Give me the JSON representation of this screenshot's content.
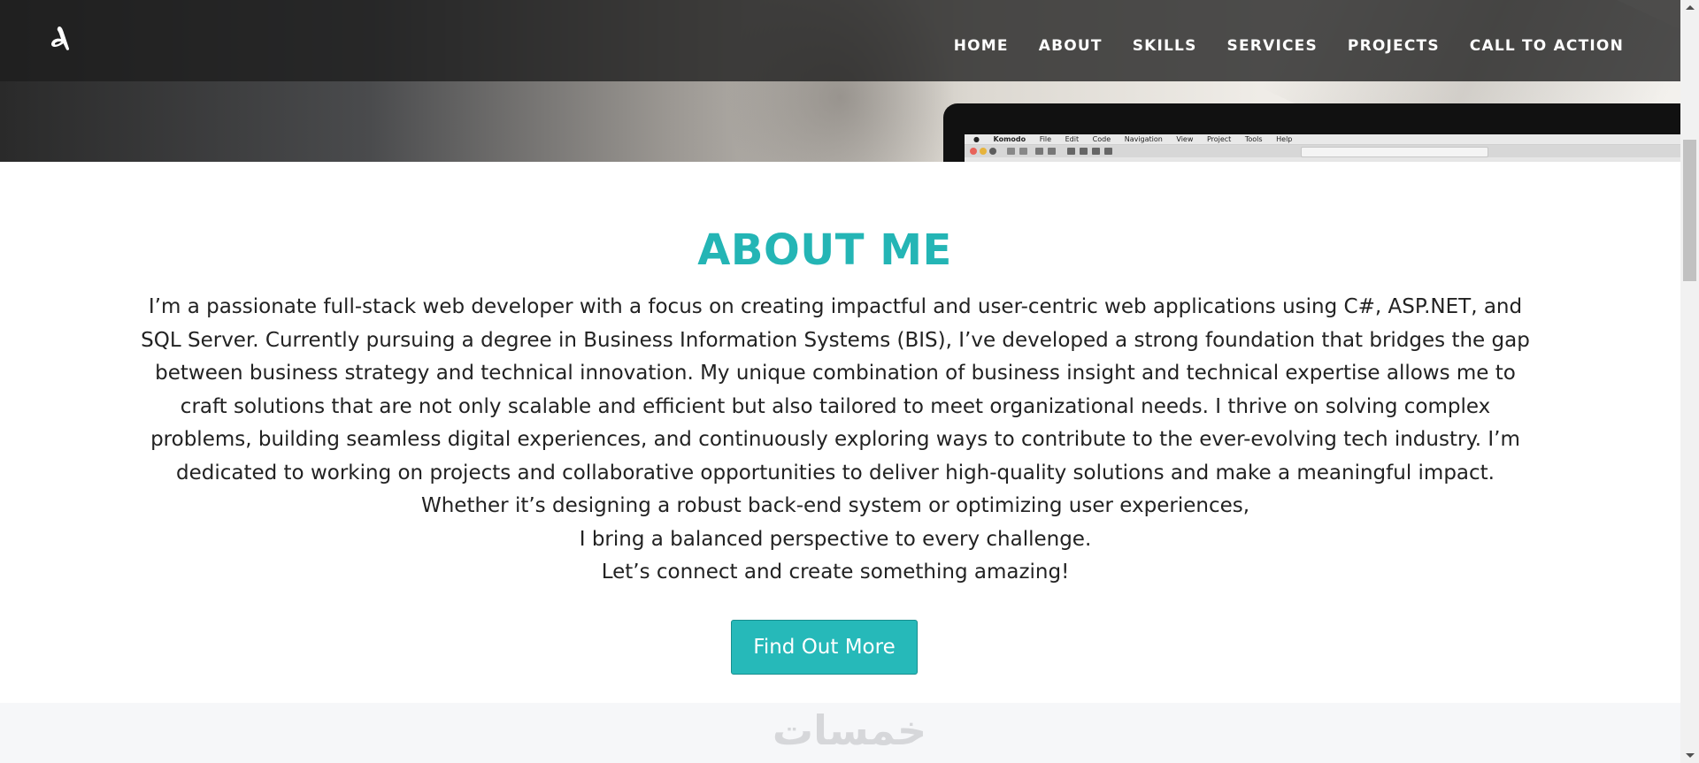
{
  "nav": {
    "logo_icon": "stylized-A-logo-icon",
    "items": [
      "HOME",
      "ABOUT",
      "SKILLS",
      "SERVICES",
      "PROJECTS",
      "CALL TO ACTION"
    ]
  },
  "hero": {
    "laptop_menu": [
      "Komodo",
      "File",
      "Edit",
      "Code",
      "Navigation",
      "View",
      "Project",
      "Tools",
      "Help"
    ]
  },
  "about": {
    "title": "ABOUT ME",
    "paragraph": "I’m a passionate full-stack web developer with a focus on creating impactful and user-centric web applications using C#, ASP.NET, and SQL Server. Currently pursuing a degree in Business Information Systems (BIS), I’ve developed a strong foundation that bridges the gap between business strategy and technical innovation. My unique combination of business insight and technical expertise allows me to craft solutions that are not only scalable and efficient but also tailored to meet organizational needs. I thrive on solving complex problems, building seamless digital experiences, and continuously exploring ways to contribute to the ever-evolving tech industry. I’m dedicated to working on projects and collaborative opportunities to deliver high-quality solutions and make a meaningful impact. Whether it’s designing a robust back-end system or optimizing user experiences,",
    "line2": "I bring a balanced perspective to every challenge.",
    "line3": "Let’s connect and create something amazing!",
    "button": "Find Out More"
  },
  "watermark_text": "خمسات",
  "colors": {
    "accent": "#24b5b5",
    "button_bg": "#26b9b9",
    "navbar_bg": "#1e1e1e",
    "text": "#222222",
    "band_bg": "#f6f7f9"
  }
}
